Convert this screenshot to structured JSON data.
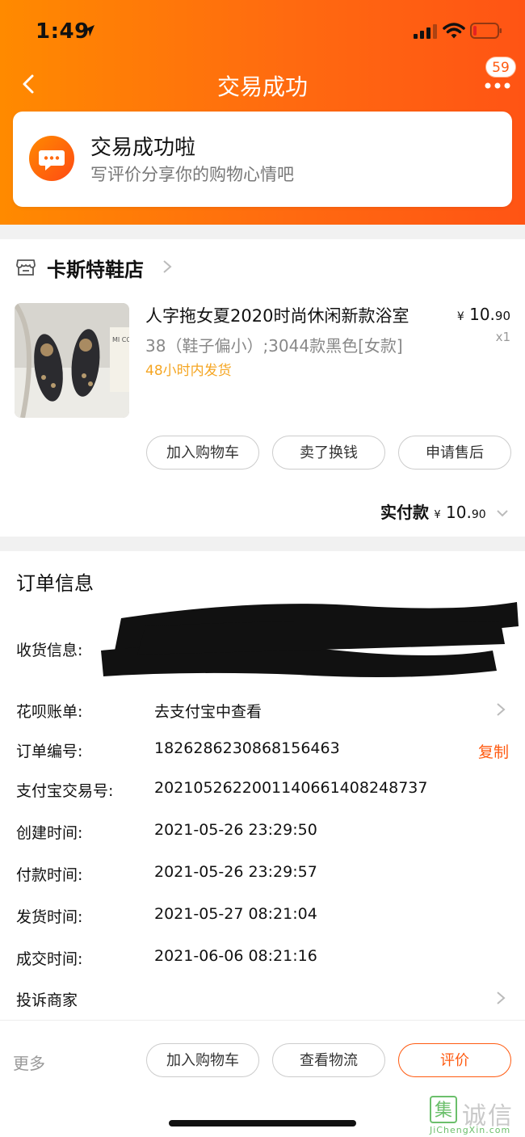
{
  "status_bar": {
    "time": "1:49"
  },
  "nav": {
    "title": "交易成功",
    "badge_count": "59"
  },
  "success_card": {
    "title": "交易成功啦",
    "subtitle": "写评价分享你的购物心情吧"
  },
  "shop": {
    "name": "卡斯特鞋店"
  },
  "product": {
    "title": "人字拖女夏2020时尚休闲新款浴室",
    "spec": "38（鞋子偏小）;3044款黑色[女款]",
    "shipping": "48小时内发货",
    "price_symbol": "¥",
    "price_int": "10.",
    "price_dec": "90",
    "quantity": "x1",
    "image_sign_text": "MI COO F AR"
  },
  "product_actions": {
    "add_cart": "加入购物车",
    "sell": "卖了换钱",
    "after_sale": "申请售后"
  },
  "payment": {
    "label": "实付款",
    "symbol": "¥",
    "int": "10.",
    "dec": "90"
  },
  "order_info": {
    "title": "订单信息",
    "receiver_label": "收货信息:",
    "huabei_label": "花呗账单:",
    "huabei_value": "去支付宝中查看",
    "order_no_label": "订单编号:",
    "order_no": "1826286230868156463",
    "copy_label": "复制",
    "alipay_no_label": "支付宝交易号:",
    "alipay_no": "2021052622001140661408248737",
    "created_label": "创建时间:",
    "created": "2021-05-26 23:29:50",
    "paid_label": "付款时间:",
    "paid": "2021-05-26 23:29:57",
    "shipped_label": "发货时间:",
    "shipped": "2021-05-27 08:21:04",
    "completed_label": "成交时间:",
    "completed": "2021-06-06 08:21:16",
    "complaint_label": "投诉商家"
  },
  "bottom_bar": {
    "more": "更多",
    "add_cart": "加入购物车",
    "logistics": "查看物流",
    "review": "评价"
  },
  "watermark": {
    "name": "诚信",
    "logo": "集",
    "url": "JiChengXin.com"
  },
  "colors": {
    "accent": "#ff5a10",
    "header_start": "#ff8a00",
    "shipping": "#f5a623"
  }
}
